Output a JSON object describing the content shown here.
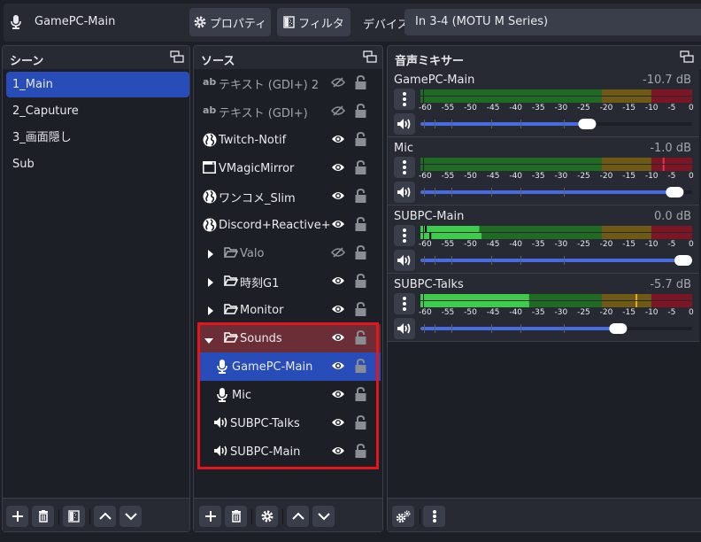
{
  "topbar": {
    "source_icon": "microphone-icon",
    "source_name": "GamePC-Main",
    "properties_label": "プロパティ",
    "filters_label": "フィルタ",
    "device_label": "デバイス",
    "device_value": "In 3-4 (MOTU M Series)"
  },
  "scenes": {
    "title": "シーン",
    "items": [
      {
        "label": "1_Main",
        "selected": true
      },
      {
        "label": "2_Caputure",
        "selected": false
      },
      {
        "label": "3_画面隠し",
        "selected": false
      },
      {
        "label": "Sub",
        "selected": false
      }
    ]
  },
  "sources": {
    "title": "ソース",
    "items": [
      {
        "label": "テキスト (GDI+) 2",
        "icon": "text-icon",
        "visible": false,
        "indent": 0
      },
      {
        "label": "テキスト (GDI+)",
        "icon": "text-icon",
        "visible": false,
        "indent": 0
      },
      {
        "label": "Twitch-Notif",
        "icon": "browser-globe-icon",
        "visible": true,
        "indent": 0
      },
      {
        "label": "VMagicMirror",
        "icon": "window-icon",
        "visible": true,
        "indent": 0
      },
      {
        "label": "ワンコメ_Slim",
        "icon": "browser-globe-icon",
        "visible": true,
        "indent": 0
      },
      {
        "label": "Discord+Reactive+-+C",
        "icon": "browser-globe-icon",
        "visible": true,
        "indent": 0
      },
      {
        "label": "Valo",
        "icon": "folder-icon",
        "visible": false,
        "group": "collapsed",
        "indent": 0
      },
      {
        "label": "時刻G1",
        "icon": "folder-icon",
        "visible": true,
        "group": "collapsed",
        "indent": 0
      },
      {
        "label": "Monitor",
        "icon": "folder-icon",
        "visible": true,
        "group": "collapsed",
        "indent": 0
      },
      {
        "label": "Sounds",
        "icon": "folder-icon",
        "visible": true,
        "group": "expanded",
        "indent": 0
      },
      {
        "label": "GamePC-Main",
        "icon": "microphone-icon",
        "visible": true,
        "indent": 1,
        "selected": true
      },
      {
        "label": "Mic",
        "icon": "microphone-icon",
        "visible": true,
        "indent": 1
      },
      {
        "label": "SUBPC-Talks",
        "icon": "speaker-icon",
        "visible": true,
        "indent": 1
      },
      {
        "label": "SUBPC-Main",
        "icon": "speaker-icon",
        "visible": true,
        "indent": 1
      }
    ]
  },
  "mixer": {
    "title": "音声ミキサー",
    "scale_labels": [
      "-60",
      "-55",
      "-50",
      "-45",
      "-40",
      "-35",
      "-30",
      "-25",
      "-20",
      "-15",
      "-10",
      "-5",
      "0"
    ],
    "channels": [
      {
        "name": "GamePC-Main",
        "db": "-10.7 dB",
        "volume_db": -10.7,
        "volume_fraction": 0.62,
        "level_db": [
          -60,
          -60
        ],
        "peak_db": [
          null,
          null
        ]
      },
      {
        "name": "Mic",
        "db": "-1.0 dB",
        "volume_db": -1.0,
        "volume_fraction": 0.96,
        "level_db": [
          -60,
          -60
        ],
        "peak_db": [
          -6.5,
          -6.5
        ]
      },
      {
        "name": "SUBPC-Main",
        "db": "0.0 dB",
        "volume_db": 0.0,
        "volume_fraction": 1.0,
        "level_db": [
          -47,
          -46.5
        ],
        "peak_db": [
          -59,
          -58
        ]
      },
      {
        "name": "SUBPC-Talks",
        "db": "-5.7 dB",
        "volume_db": -5.7,
        "volume_fraction": 0.74,
        "level_db": [
          -36,
          -36
        ],
        "peak_db": [
          -12.5,
          -12.5
        ]
      }
    ]
  },
  "colors": {
    "accent_selected": "#284cb8",
    "group_row": "#6b2e36",
    "highlight_box": "#e4151c",
    "meter_green_dim": "#1f6b24",
    "meter_green": "#3dcc4b",
    "meter_yellow_dim": "#6e5a15",
    "meter_red_dim": "#7c1625"
  }
}
